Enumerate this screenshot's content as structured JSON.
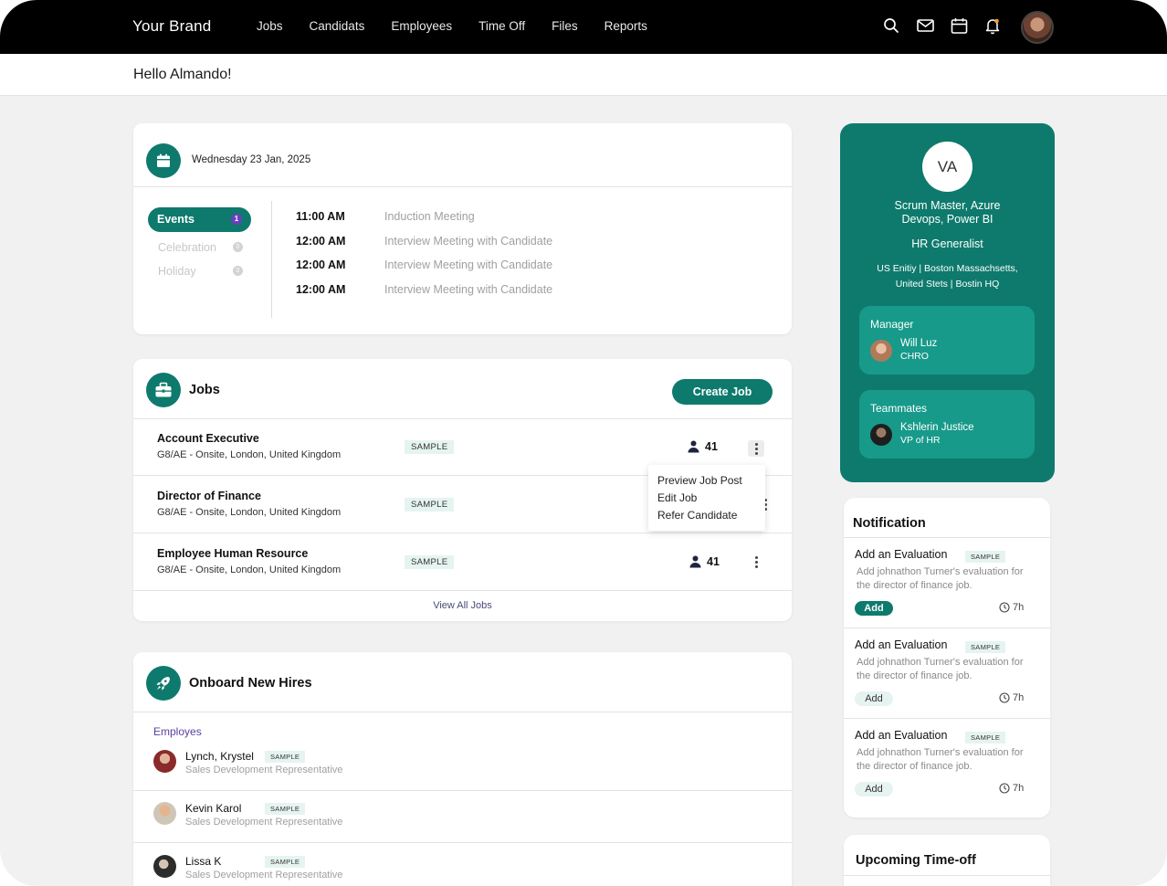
{
  "nav": {
    "brand": "Your Brand",
    "links": [
      "Jobs",
      "Candidats",
      "Employees",
      "Time Off",
      "Files",
      "Reports"
    ],
    "icons": [
      "search-icon",
      "mail-icon",
      "calendar-icon",
      "bell-icon"
    ]
  },
  "greeting": "Hello Almando!",
  "events": {
    "date": "Wednesday 23 Jan, 2025",
    "categories": [
      {
        "label": "Events",
        "count": "1"
      },
      {
        "label": "Celebration",
        "count": "0"
      },
      {
        "label": "Holiday",
        "count": "0"
      }
    ],
    "items": [
      {
        "time": "11:00 AM",
        "title": "Induction Meeting"
      },
      {
        "time": "12:00 AM",
        "title": "Interview Meeting with Candidate"
      },
      {
        "time": "12:00 AM",
        "title": "Interview Meeting with Candidate"
      },
      {
        "time": "12:00 AM",
        "title": "Interview Meeting with Candidate"
      }
    ]
  },
  "jobs": {
    "title": "Jobs",
    "create_label": "Create Job",
    "rows": [
      {
        "title": "Account Executive",
        "sub": "G8/AE - Onsite, London, United Kingdom",
        "badge": "SAMPLE",
        "count": "41"
      },
      {
        "title": "Director of Finance",
        "sub": "G8/AE - Onsite, London, United Kingdom",
        "badge": "SAMPLE",
        "count": "41"
      },
      {
        "title": "Employee Human Resource",
        "sub": "G8/AE - Onsite, London, United Kingdom",
        "badge": "SAMPLE",
        "count": "41"
      }
    ],
    "menu": [
      "Preview Job Post",
      "Edit Job",
      "Refer Candidate"
    ],
    "view_all": "View All Jobs"
  },
  "onboard": {
    "title": "Onboard New Hires",
    "section": "Employes",
    "people": [
      {
        "name": "Lynch, Krystel",
        "role": "Sales Development Representative",
        "badge": "SAMPLE"
      },
      {
        "name": "Kevin Karol",
        "role": "Sales Development Representative",
        "badge": "SAMPLE"
      },
      {
        "name": "Lissa K",
        "role": "Sales Development Representative",
        "badge": "SAMPLE"
      }
    ]
  },
  "profile": {
    "initials": "VA",
    "title_line1": "Scrum Master, Azure",
    "title_line2": "Devops, Power BI",
    "role": "HR Generalist",
    "location_line1": "US Enitiy | Boston Massachsetts,",
    "location_line2": "United Stets | Bostin HQ",
    "manager": {
      "heading": "Manager",
      "name": "Will Luz",
      "role": "CHRO"
    },
    "teammates": {
      "heading": "Teammates",
      "name": "Kshlerin Justice",
      "role": "VP of HR"
    }
  },
  "notifications": {
    "title": "Notification",
    "items": [
      {
        "title": "Add an Evaluation",
        "badge": "SAMPLE",
        "desc": "Add johnathon Turner's evaluation for the director of finance job.",
        "action": "Add",
        "ago": "7h"
      },
      {
        "title": "Add an Evaluation",
        "badge": "SAMPLE",
        "desc": "Add johnathon Turner's evaluation for the director of finance job.",
        "action": "Add",
        "ago": "7h"
      },
      {
        "title": "Add an Evaluation",
        "badge": "SAMPLE",
        "desc": "Add johnathon Turner's evaluation for the director of finance job.",
        "action": "Add",
        "ago": "7h"
      }
    ]
  },
  "timeoff": {
    "title": "Upcoming Time-off"
  },
  "colors": {
    "accent": "#0e7a6d",
    "accent_light": "#179a8a",
    "badge_bg": "#e6f4f1"
  }
}
